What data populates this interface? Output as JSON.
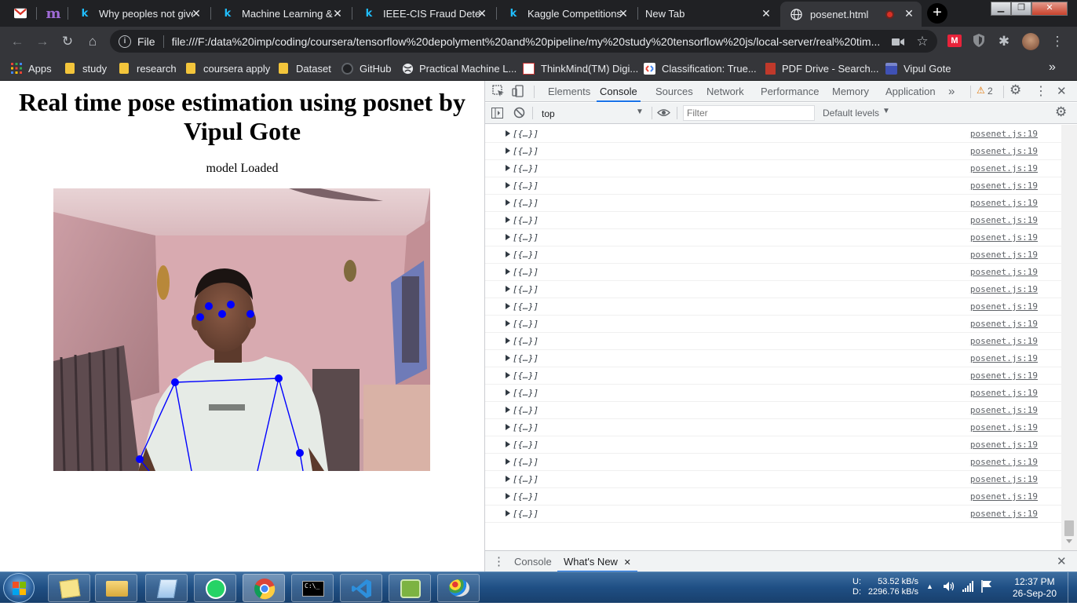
{
  "tabs": [
    {
      "title": "",
      "icon": "gmail-icon"
    },
    {
      "title": "",
      "icon": "medium-icon"
    },
    {
      "title": "Why peoples not give",
      "icon": "kaggle-icon"
    },
    {
      "title": "Machine Learning & D",
      "icon": "kaggle-icon"
    },
    {
      "title": "IEEE-CIS Fraud Detecti",
      "icon": "kaggle-icon"
    },
    {
      "title": "Kaggle Competitions",
      "icon": "kaggle-icon"
    },
    {
      "title": "New Tab",
      "icon": ""
    },
    {
      "title": "posenet.html",
      "icon": "globe-icon",
      "active": true
    }
  ],
  "omnibox": {
    "scheme": "File",
    "url": "file:///F:/data%20imp/coding/coursera/tensorflow%20depolyment%20and%20pipeline/my%20study%20tensorflow%20js/local-server/real%20tim..."
  },
  "bookmarks": [
    {
      "label": "Apps",
      "icon": "apps-grid-icon"
    },
    {
      "label": "study",
      "icon": "folder-icon"
    },
    {
      "label": "research",
      "icon": "folder-icon"
    },
    {
      "label": "coursera apply",
      "icon": "folder-icon"
    },
    {
      "label": "Dataset",
      "icon": "folder-icon"
    },
    {
      "label": "GitHub",
      "icon": "github-icon"
    },
    {
      "label": "Practical Machine L...",
      "icon": "globe-icon"
    },
    {
      "label": "ThinkMind(TM) Digi...",
      "icon": "thinkmind-icon"
    },
    {
      "label": "Classification: True...",
      "icon": "google-dev-icon"
    },
    {
      "label": "PDF Drive - Search...",
      "icon": "pdfdrive-icon"
    },
    {
      "label": "Vipul Gote",
      "icon": "site-icon"
    }
  ],
  "page": {
    "title": "Real time pose estimation using posnet by Vipul Gote",
    "status": "model Loaded"
  },
  "devtools": {
    "tabs": [
      "Elements",
      "Console",
      "Sources",
      "Network",
      "Performance",
      "Memory",
      "Application"
    ],
    "active_tab": "Console",
    "overflow": "»",
    "warning_count": "2",
    "context": "top",
    "filter_placeholder": "Filter",
    "levels": "Default levels",
    "log_message": "[{…}]",
    "log_source": "posenet.js:19",
    "log_count": 23,
    "prompt": "›",
    "drawer_tabs": [
      "Console",
      "What's New"
    ]
  },
  "taskbar": {
    "net_upload_label": "U:",
    "net_upload": "53.52 kB/s",
    "net_download_label": "D:",
    "net_download": "2296.76 kB/s",
    "time": "12:37 PM",
    "date": "26-Sep-20"
  },
  "colors": {
    "keypoint": "#0000ff",
    "tabstrip": "#202124",
    "toolbar": "#35363a",
    "devtools_accent": "#1a73e8"
  }
}
